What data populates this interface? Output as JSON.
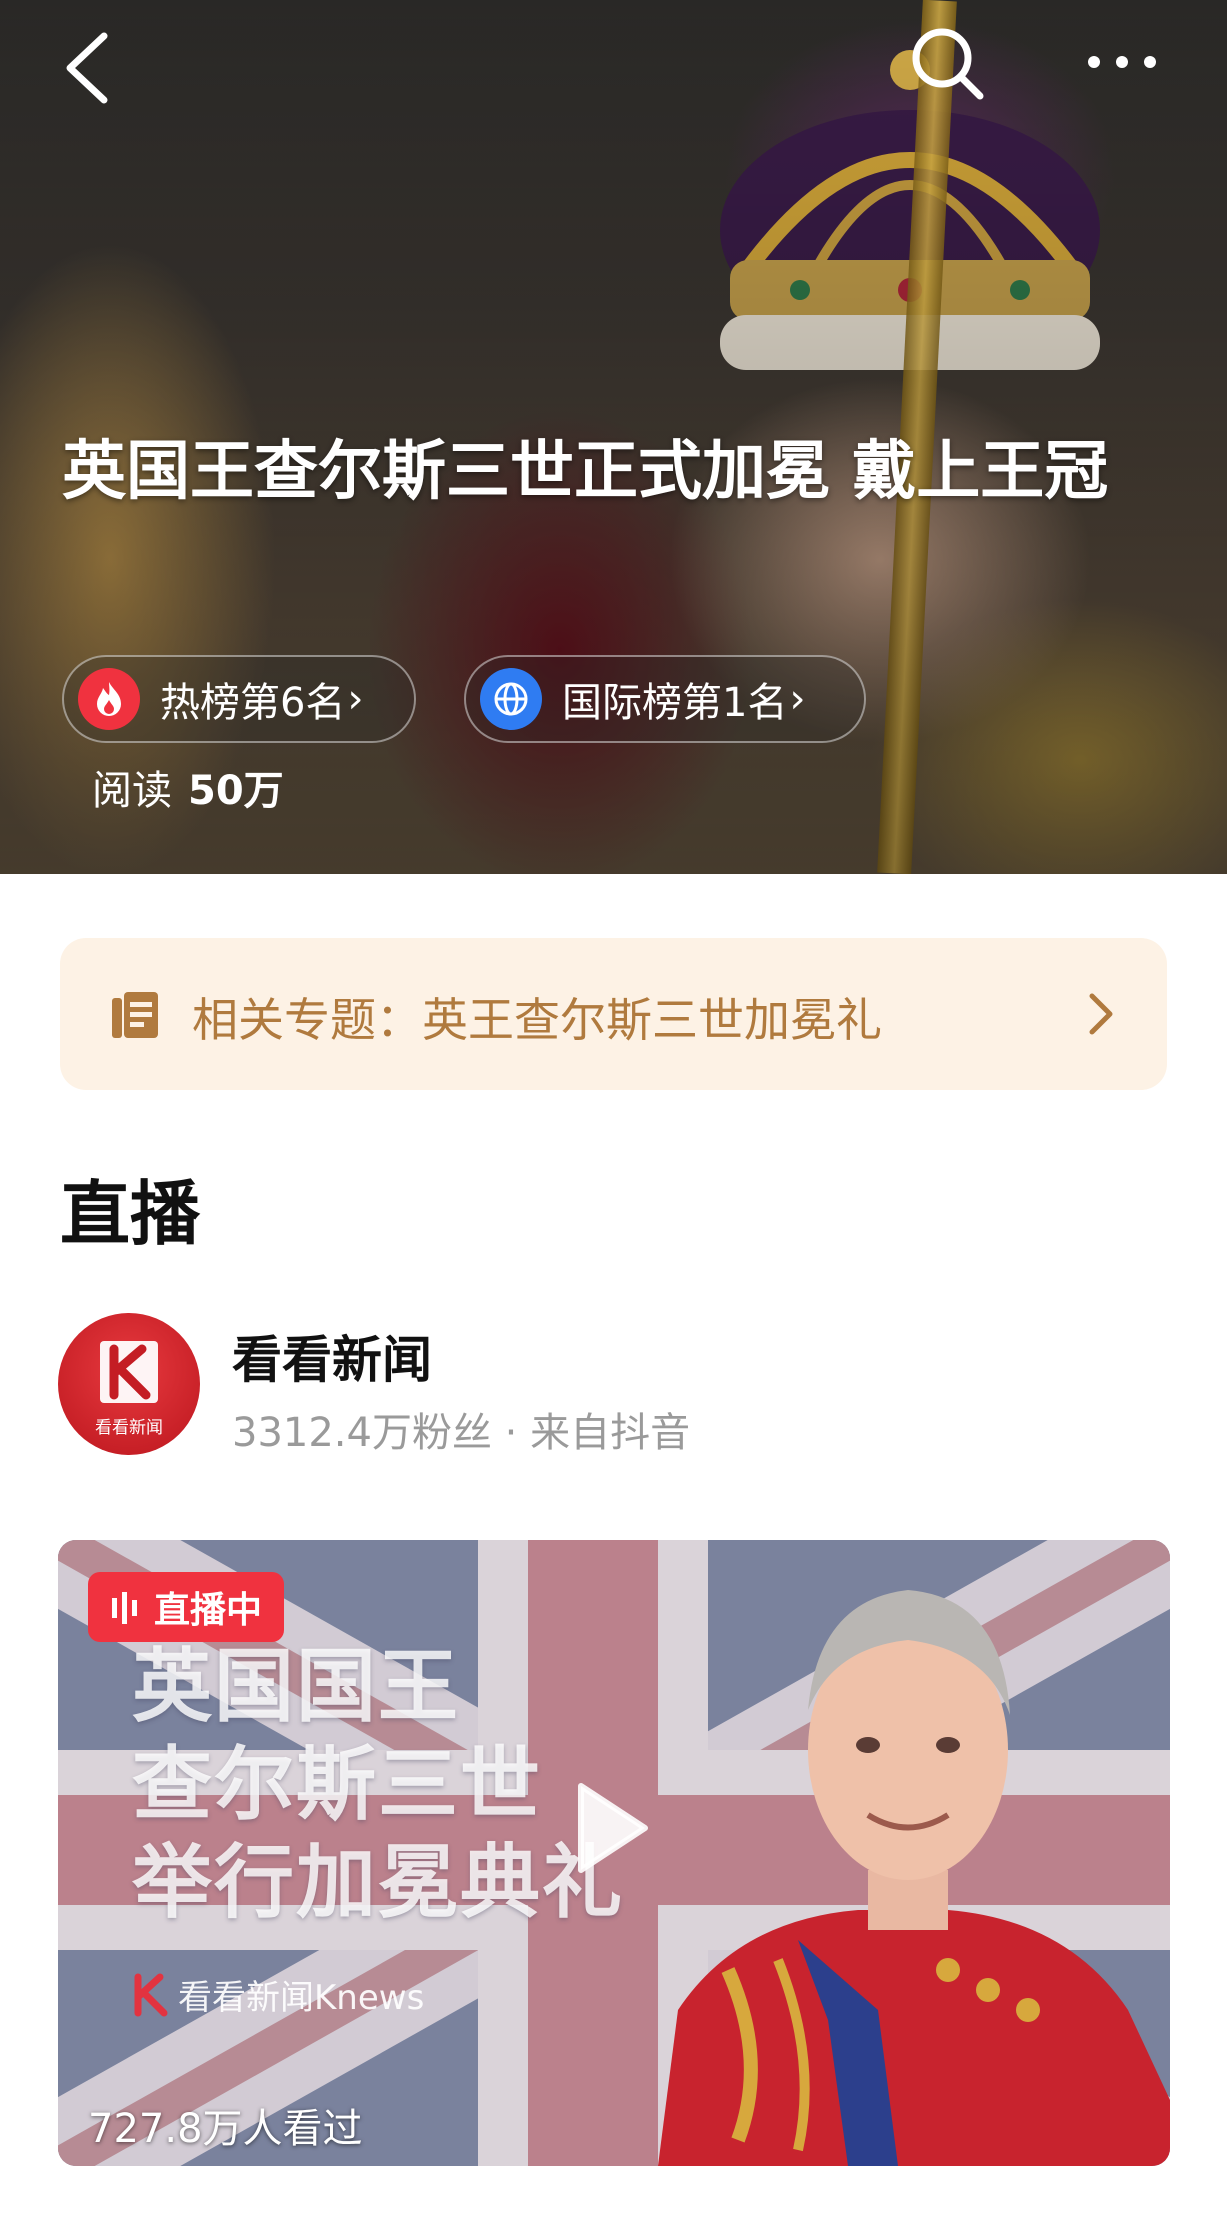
{
  "hero": {
    "title": "英国王查尔斯三世正式加冕 戴上王冠",
    "hot_rank": "热榜第6名",
    "intl_rank": "国际榜第1名",
    "read_label": "阅读",
    "read_count": "50万"
  },
  "topic": {
    "text": "相关专题：英王查尔斯三世加冕礼"
  },
  "live": {
    "section_title": "直播",
    "author_name": "看看新闻",
    "author_meta": "3312.4万粉丝 · 来自抖音",
    "avatar_caption": "看看新闻",
    "badge": "直播中",
    "video_title_lines": [
      "英国国王",
      "查尔斯三世",
      "举行加冕典礼"
    ],
    "brand": "看看新闻Knews",
    "views": "727.8万人看过"
  },
  "colors": {
    "live_red": "#f0323f",
    "topic_bg": "#fdf2e5",
    "topic_text": "#b07a3e",
    "meta_gray": "#9a9a9a"
  }
}
